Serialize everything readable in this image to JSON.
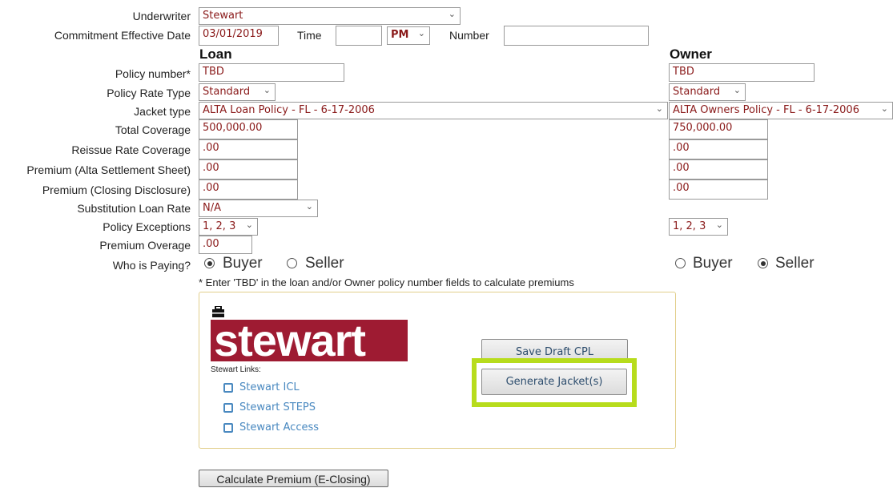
{
  "header": {
    "underwriter_label": "Underwriter",
    "underwriter_value": "Stewart",
    "commitment_label": "Commitment Effective Date",
    "commitment_value": "03/01/2019",
    "time_label": "Time",
    "time_value": "",
    "ampm_value": "PM",
    "number_label": "Number",
    "number_value": ""
  },
  "columns": {
    "loan": "Loan",
    "owner": "Owner"
  },
  "rows": {
    "policy_number": {
      "label": "Policy number*",
      "loan": "TBD",
      "owner": "TBD"
    },
    "policy_rate_type": {
      "label": "Policy Rate Type",
      "loan": "Standard",
      "owner": "Standard"
    },
    "jacket_type": {
      "label": "Jacket type",
      "loan": "ALTA Loan Policy - FL - 6-17-2006",
      "owner": "ALTA Owners Policy - FL - 6-17-2006"
    },
    "total_coverage": {
      "label": "Total Coverage",
      "loan": "500,000.00",
      "owner": "750,000.00"
    },
    "reissue_rate": {
      "label": "Reissue Rate Coverage",
      "loan": ".00",
      "owner": ".00"
    },
    "premium_alta": {
      "label": "Premium (Alta Settlement Sheet)",
      "loan": ".00",
      "owner": ".00"
    },
    "premium_closing": {
      "label": "Premium (Closing Disclosure)",
      "loan": ".00",
      "owner": ".00"
    },
    "substitution": {
      "label": "Substitution Loan Rate",
      "loan": "N/A"
    },
    "exceptions": {
      "label": "Policy Exceptions",
      "loan": "1, 2, 3",
      "owner": "1, 2, 3"
    },
    "overage": {
      "label": "Premium Overage",
      "loan": ".00"
    }
  },
  "paying": {
    "label": "Who is Paying?",
    "buyer": "Buyer",
    "seller": "Seller",
    "loan_selected": "Buyer",
    "owner_selected": "Seller"
  },
  "note": "* Enter 'TBD' in the loan and/or Owner policy number fields to calculate premiums",
  "panel": {
    "logo_text": "stewart",
    "links_label": "Stewart Links:",
    "links": [
      "Stewart ICL",
      "Stewart STEPS",
      "Stewart Access"
    ],
    "save_draft": "Save Draft CPL",
    "generate": "Generate Jacket(s)",
    "highlight_color": "#b7dc1c",
    "brand_color": "#9e1b32"
  },
  "calculate_button": "Calculate Premium (E-Closing)"
}
